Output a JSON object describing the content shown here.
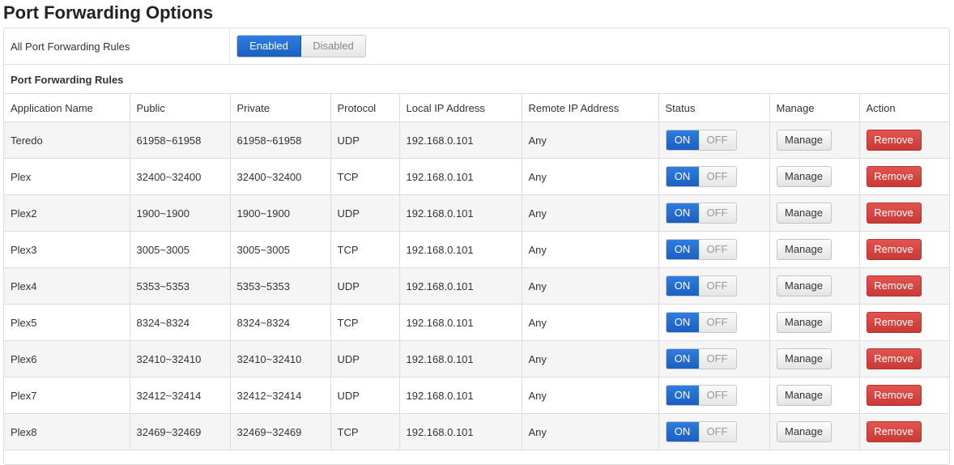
{
  "page_title": "Port Forwarding Options",
  "all_rules": {
    "label": "All Port Forwarding Rules",
    "enabled_label": "Enabled",
    "disabled_label": "Disabled",
    "selected": "Enabled"
  },
  "section_title": "Port Forwarding Rules",
  "columns": {
    "app": "Application Name",
    "public": "Public",
    "private": "Private",
    "protocol": "Protocol",
    "local_ip": "Local IP Address",
    "remote_ip": "Remote IP Address",
    "status": "Status",
    "manage": "Manage",
    "action": "Action"
  },
  "buttons": {
    "on": "ON",
    "off": "OFF",
    "manage": "Manage",
    "remove": "Remove"
  },
  "rules": [
    {
      "name": "Teredo",
      "public": "61958~61958",
      "private": "61958~61958",
      "protocol": "UDP",
      "local_ip": "192.168.0.101",
      "remote_ip": "Any",
      "status": "ON"
    },
    {
      "name": "Plex",
      "public": "32400~32400",
      "private": "32400~32400",
      "protocol": "TCP",
      "local_ip": "192.168.0.101",
      "remote_ip": "Any",
      "status": "ON"
    },
    {
      "name": "Plex2",
      "public": "1900~1900",
      "private": "1900~1900",
      "protocol": "UDP",
      "local_ip": "192.168.0.101",
      "remote_ip": "Any",
      "status": "ON"
    },
    {
      "name": "Plex3",
      "public": "3005~3005",
      "private": "3005~3005",
      "protocol": "TCP",
      "local_ip": "192.168.0.101",
      "remote_ip": "Any",
      "status": "ON"
    },
    {
      "name": "Plex4",
      "public": "5353~5353",
      "private": "5353~5353",
      "protocol": "UDP",
      "local_ip": "192.168.0.101",
      "remote_ip": "Any",
      "status": "ON"
    },
    {
      "name": "Plex5",
      "public": "8324~8324",
      "private": "8324~8324",
      "protocol": "TCP",
      "local_ip": "192.168.0.101",
      "remote_ip": "Any",
      "status": "ON"
    },
    {
      "name": "Plex6",
      "public": "32410~32410",
      "private": "32410~32410",
      "protocol": "UDP",
      "local_ip": "192.168.0.101",
      "remote_ip": "Any",
      "status": "ON"
    },
    {
      "name": "Plex7",
      "public": "32412~32414",
      "private": "32412~32414",
      "protocol": "UDP",
      "local_ip": "192.168.0.101",
      "remote_ip": "Any",
      "status": "ON"
    },
    {
      "name": "Plex8",
      "public": "32469~32469",
      "private": "32469~32469",
      "protocol": "TCP",
      "local_ip": "192.168.0.101",
      "remote_ip": "Any",
      "status": "ON"
    }
  ],
  "colors": {
    "accent_blue": "#1a5fc4",
    "remove_red": "#c73a35",
    "stripe": "#f5f5f5"
  }
}
